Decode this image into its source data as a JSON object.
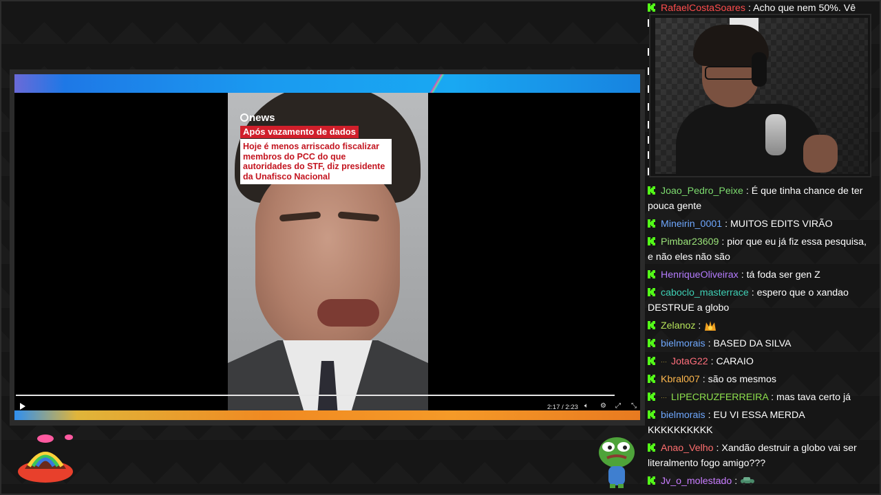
{
  "video": {
    "news_logo": "news",
    "tag": "Após vazamento de dados",
    "headline": "Hoje é menos arriscado fiscalizar membros do PCC do que autoridades do STF, diz presidente da Unafisco Nacional",
    "time": "2:17 / 2:23",
    "progress": 0.958
  },
  "chat": {
    "messages": [
      {
        "user": "RafaelCostaSoares",
        "color": "#ff4d4d",
        "text": "Acho que nem 50%. Vê",
        "badge": "kick"
      },
      {
        "user": "Joao_Pedro_Peixe",
        "color": "#7ddc6f",
        "text": "É que tinha chance de ter pouca gente",
        "badge": "kick"
      },
      {
        "user": "Mineirin_0001",
        "color": "#6fa8ff",
        "text": "MUITOS EDITS VIRÃO",
        "badge": "kick"
      },
      {
        "user": "Pimbar23609",
        "color": "#9be37a",
        "text": "pior que eu já fiz essa pesquisa, e não eles não são",
        "badge": "kick"
      },
      {
        "user": "HenriqueOliveirax",
        "color": "#b57cff",
        "text": "tá foda ser gen Z",
        "badge": "kick"
      },
      {
        "user": "caboclo_masterrace",
        "color": "#3fd0b5",
        "text": "espero que o xandao DESTRUE a globo",
        "badge": "kick"
      },
      {
        "user": "Zelanoz",
        "color": "#b6e35a",
        "text": "",
        "badge": "kick",
        "emote": "fire-crown-emote"
      },
      {
        "user": "bielmorais",
        "color": "#6fa8ff",
        "text": "BASED DA SILVA",
        "badge": "kick"
      },
      {
        "user": "JotaG22",
        "color": "#ff6f7c",
        "text": "CARAIO",
        "badge": "kick-dots"
      },
      {
        "user": "Kbral007",
        "color": "#ffb84d",
        "text": "são os mesmos",
        "badge": "kick"
      },
      {
        "user": "LIPECRUZFERREIRA",
        "color": "#8ee04d",
        "text": "mas tava certo já",
        "badge": "kick-dots"
      },
      {
        "user": "bielmorais",
        "color": "#6fa8ff",
        "text": "EU VI ESSA MERDA KKKKKKKKKK",
        "badge": "kick"
      },
      {
        "user": "Anao_Velho",
        "color": "#ff6f6f",
        "text": "Xandão destruir a globo vai ser literalmento fogo amigo???",
        "badge": "kick"
      },
      {
        "user": "Jv_o_molestado",
        "color": "#c87cff",
        "text": "",
        "badge": "kick",
        "emote": "car-emote"
      }
    ]
  },
  "colors": {
    "kick_green": "#53fc18",
    "headline_red": "#c3141f",
    "tag_red": "#d11f2b"
  }
}
